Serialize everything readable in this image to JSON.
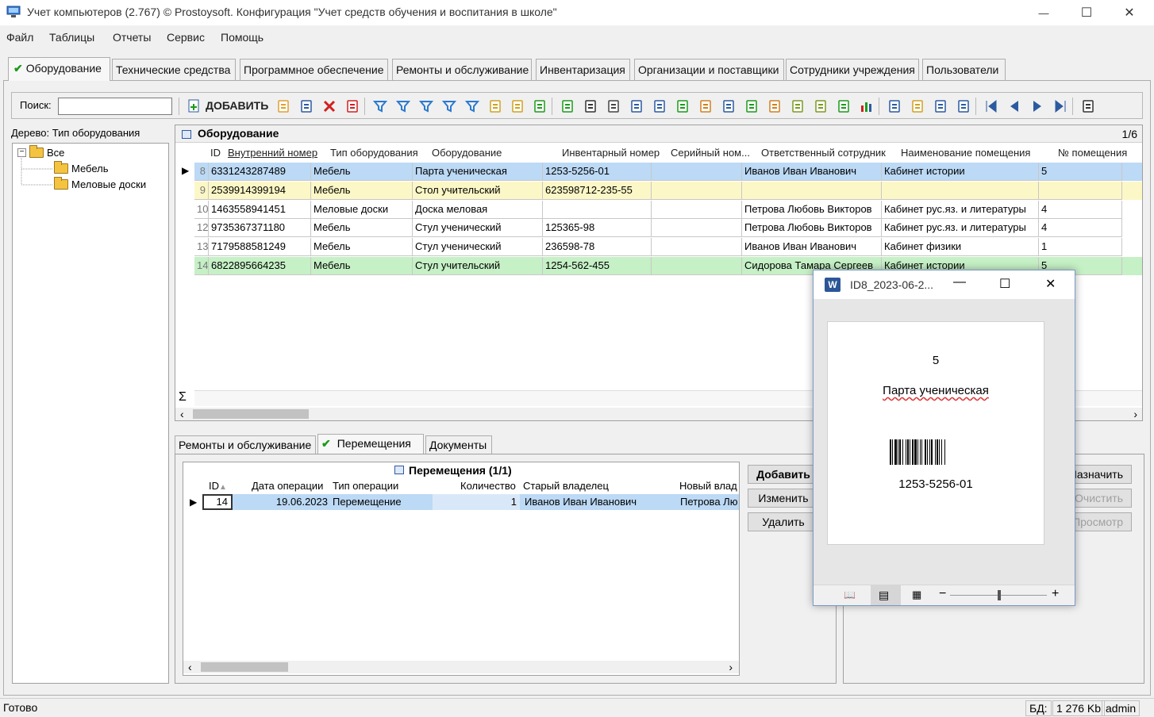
{
  "window": {
    "title": "Учет компьютеров (2.767) © Prostoysoft. Конфигурация \"Учет средств обучения и воспитания в школе\"",
    "minimize_glyph": "—",
    "maximize_glyph": "☐",
    "close_glyph": "✕"
  },
  "menu": [
    "Файл",
    "Таблицы",
    "Отчеты",
    "Сервис",
    "Помощь"
  ],
  "tabs": [
    {
      "label": "Оборудование",
      "active": true
    },
    {
      "label": "Технические средства"
    },
    {
      "label": "Программное обеспечение"
    },
    {
      "label": "Ремонты и обслуживание"
    },
    {
      "label": "Инвентаризация"
    },
    {
      "label": "Организации и поставщики"
    },
    {
      "label": "Сотрудники учреждения"
    },
    {
      "label": "Пользователи"
    }
  ],
  "toolbar": {
    "search_label": "Поиск:",
    "search_value": "",
    "add_label": "ДОБАВИТЬ",
    "icons": [
      "edit-icon",
      "copy-icon",
      "delete-icon",
      "delete-table-icon",
      "filter-icon",
      "filter-remove-icon",
      "filter-clear-icon",
      "filter-options-icon",
      "filter-saved-icon",
      "group-filter-icon",
      "tree-view-icon",
      "sql-icon",
      "refresh-icon",
      "find-icon",
      "print-icon",
      "preview-icon",
      "export-word-icon",
      "export-excel-icon",
      "export-html-icon",
      "report-word-icon",
      "report-excel-icon",
      "report-icon",
      "csv-icon",
      "xml-icon",
      "xls-icon",
      "chart-icon",
      "sort-icon",
      "doc-icon",
      "columns-icon",
      "layout-icon",
      "first-icon",
      "prev-icon",
      "next-icon",
      "last-icon",
      "clipboard-icon"
    ]
  },
  "tree": {
    "header": "Дерево: Тип оборудования",
    "root": "Все",
    "children": [
      "Мебель",
      "Меловые доски"
    ]
  },
  "grid": {
    "title": "Оборудование",
    "page": "1/6",
    "columns": [
      "ID",
      "Внутренний номер",
      "Тип оборудования",
      "Оборудование",
      "Инвентарный номер",
      "Серийный ном...",
      "Ответственный сотрудник",
      "Наименование помещения",
      "№ помещения"
    ],
    "rows": [
      [
        "8",
        "6331243287489",
        "Мебель",
        "Парта ученическая",
        "1253-5256-01",
        "",
        "Иванов Иван Иванович",
        "Кабинет истории",
        "5"
      ],
      [
        "9",
        "2539914399194",
        "Мебель",
        "Стол учительский",
        "623598712-235-55",
        "",
        "",
        "",
        ""
      ],
      [
        "10",
        "1463558941451",
        "Меловые доски",
        "Доска меловая",
        "",
        "",
        "Петрова Любовь Викторов",
        "Кабинет рус.яз. и литературы",
        "4"
      ],
      [
        "12",
        "9735367371180",
        "Мебель",
        "Стул ученический",
        "125365-98",
        "",
        "Петрова Любовь Викторов",
        "Кабинет рус.яз. и литературы",
        "4"
      ],
      [
        "13",
        "7179588581249",
        "Мебель",
        "Стул ученический",
        "236598-78",
        "",
        "Иванов Иван Иванович",
        "Кабинет физики",
        "1"
      ],
      [
        "14",
        "6822895664235",
        "Мебель",
        "Стул учительский",
        "1254-562-455",
        "",
        "Сидорова Тамара Сергеев",
        "Кабинет истории",
        "5"
      ]
    ],
    "row_colors": [
      "#bcd9f5",
      "#fcf7c6",
      "#ffffff",
      "#ffffff",
      "#ffffff",
      "#c6f0c6"
    ],
    "sum_glyph": "Σ"
  },
  "lower_tabs": [
    {
      "label": "Ремонты и обслуживание"
    },
    {
      "label": "Перемещения",
      "active": true
    },
    {
      "label": "Документы"
    }
  ],
  "movements": {
    "title": "Перемещения (1/1)",
    "columns": [
      "ID",
      "Дата операции",
      "Тип операции",
      "Количество",
      "Старый владелец",
      "Новый влад"
    ],
    "row": [
      "14",
      "19.06.2023",
      "Перемещение",
      "1",
      "Иванов Иван Иванович",
      "Петрова Лю"
    ]
  },
  "buttons": {
    "add": "Добавить",
    "edit": "Изменить",
    "delete": "Удалить",
    "assign": "Назначить",
    "clear": "Очистить",
    "view": "Просмотр"
  },
  "status": {
    "left": "Готово",
    "db_label": "БД:",
    "db_size": "1 276 Kb",
    "user": "admin"
  },
  "popup": {
    "title": "ID8_2023-06-2...",
    "room": "5",
    "name": "Парта ученическая",
    "barcode_text": "1253-5256-01"
  }
}
